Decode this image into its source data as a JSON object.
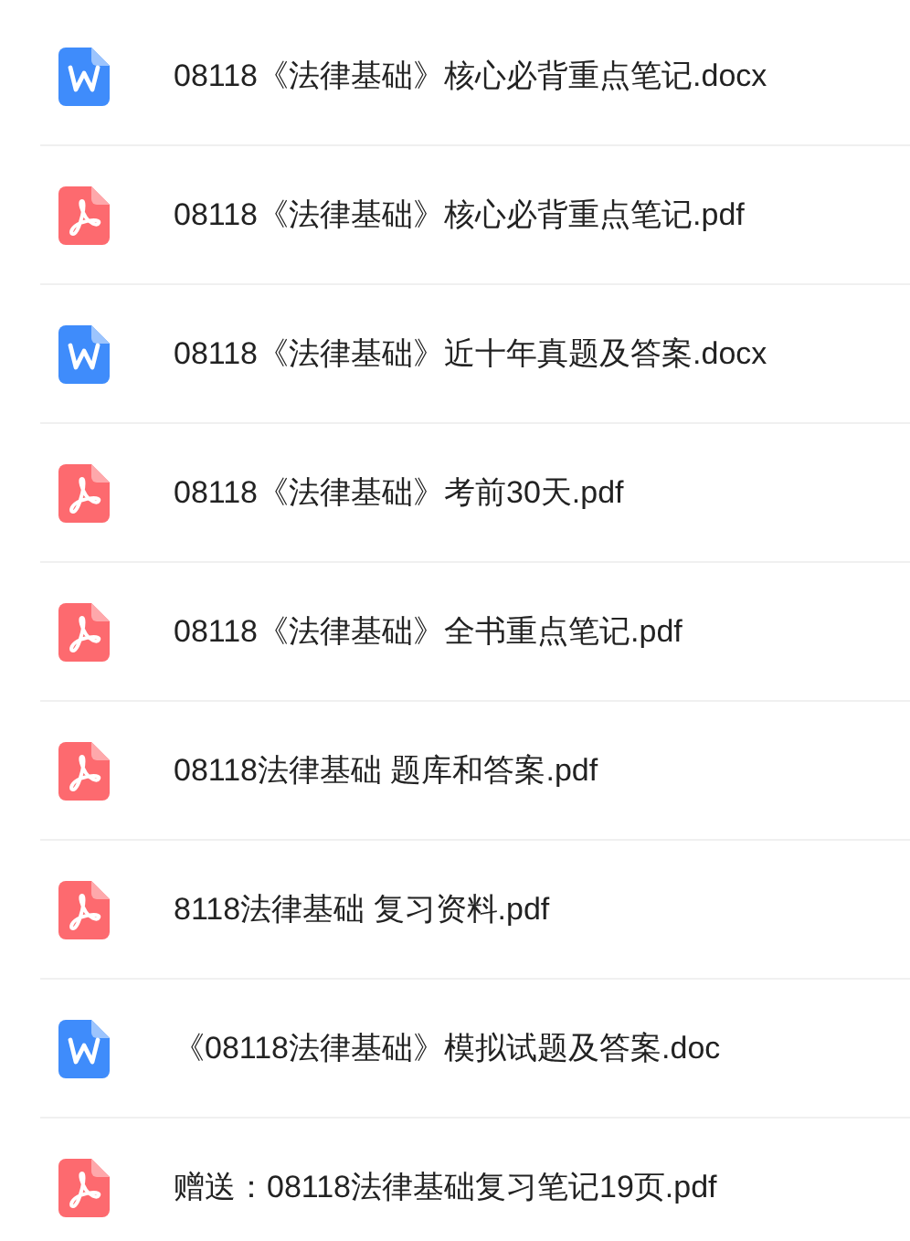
{
  "files": [
    {
      "kind": "word",
      "name": "08118《法律基础》核心必背重点笔记.docx"
    },
    {
      "kind": "pdf",
      "name": "08118《法律基础》核心必背重点笔记.pdf"
    },
    {
      "kind": "word",
      "name": "08118《法律基础》近十年真题及答案.docx"
    },
    {
      "kind": "pdf",
      "name": "08118《法律基础》考前30天.pdf"
    },
    {
      "kind": "pdf",
      "name": "08118《法律基础》全书重点笔记.pdf"
    },
    {
      "kind": "pdf",
      "name": "08118法律基础 题库和答案.pdf"
    },
    {
      "kind": "pdf",
      "name": "8118法律基础 复习资料.pdf"
    },
    {
      "kind": "word",
      "name": "《08118法律基础》模拟试题及答案.doc"
    },
    {
      "kind": "pdf",
      "name": "赠送：08118法律基础复习笔记19页.pdf"
    }
  ]
}
